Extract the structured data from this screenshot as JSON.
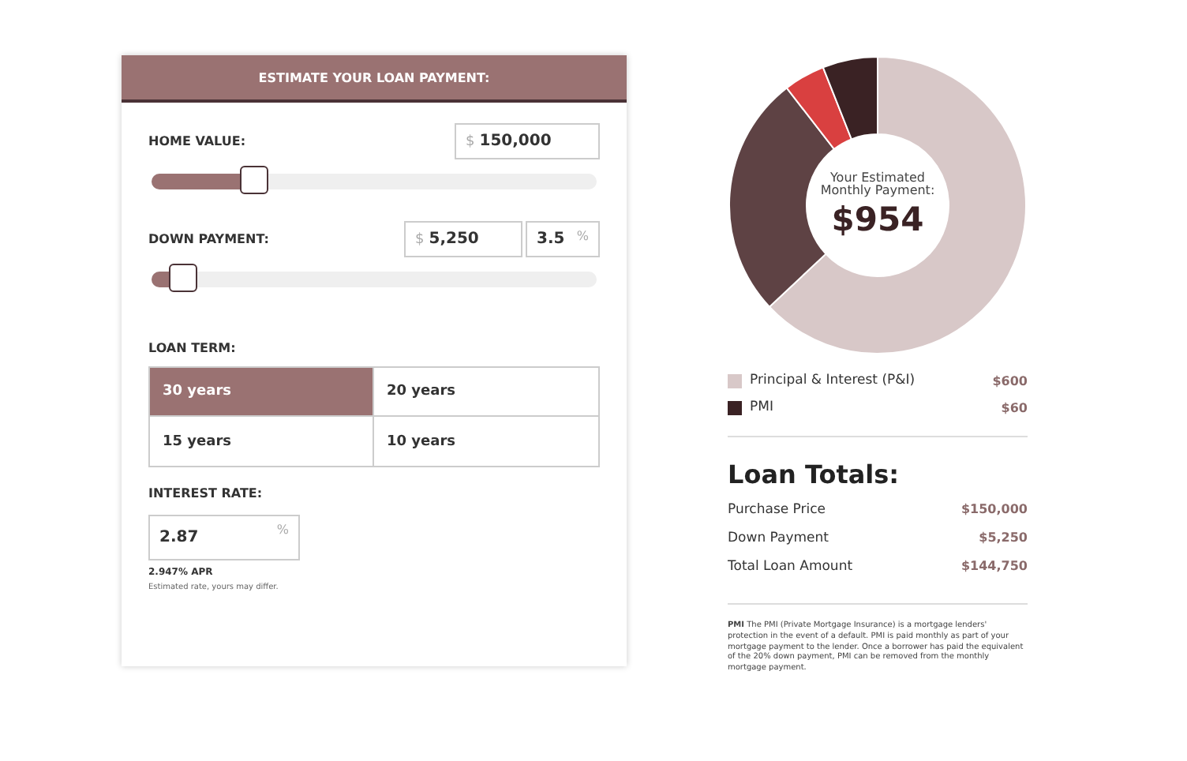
{
  "calculator": {
    "title": "ESTIMATE YOUR LOAN PAYMENT:",
    "home_value": {
      "label": "HOME VALUE:",
      "prefix": "$",
      "value": "150,000",
      "level": 0.23
    },
    "down_payment": {
      "label": "DOWN PAYMENT:",
      "prefix": "$",
      "value": "5,250",
      "percent": "3.5",
      "percent_suffix": "%",
      "level": 0.07
    },
    "loan_term": {
      "label": "LOAN TERM:",
      "options": [
        {
          "label": "30 years",
          "selected": true
        },
        {
          "label": "20 years",
          "selected": false
        },
        {
          "label": "15 years",
          "selected": false
        },
        {
          "label": "10 years",
          "selected": false
        }
      ]
    },
    "interest_rate": {
      "label": "INTEREST RATE:",
      "value": "2.87",
      "suffix": "%",
      "apr": "2.947% APR",
      "note": "Estimated rate, yours may differ."
    }
  },
  "summary": {
    "donut_caption": "Your Estimated Monthly Payment:",
    "monthly_payment": "$954",
    "legend": [
      {
        "label": "Principal & Interest (P&I)",
        "amount": "$600",
        "color": "#d8c8c8"
      },
      {
        "label": "PMI",
        "amount": "$60",
        "color": "#3a2224"
      }
    ],
    "totals_title": "Loan Totals:",
    "totals": [
      {
        "label": "Purchase Price",
        "amount": "$150,000"
      },
      {
        "label": "Down Payment",
        "amount": "$5,250"
      },
      {
        "label": "Total Loan Amount",
        "amount": "$144,750"
      }
    ],
    "footnote": "**PMI** The PMI (Private Mortgage Insurance) is a mortgage lenders' protection in the event of a default. PMI is paid monthly as part of your mortgage payment to the lender. Once a borrower has paid the equivalent of the 20% down payment, PMI can be removed from the monthly mortgage payment."
  }
}
